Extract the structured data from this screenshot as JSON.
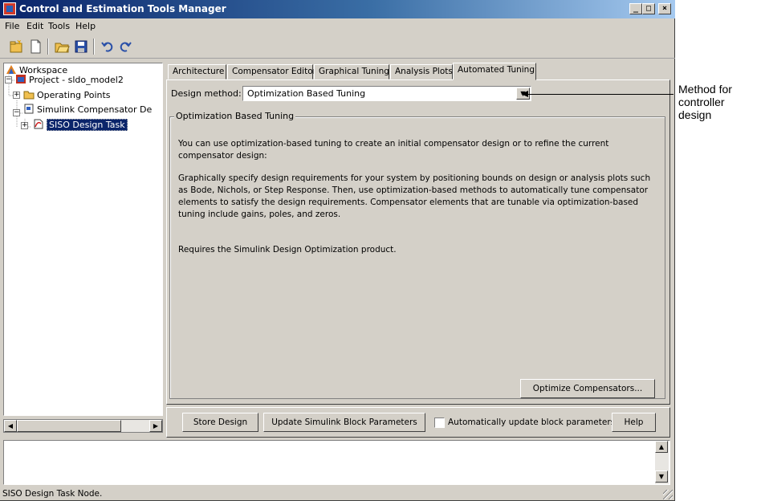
{
  "window": {
    "title": "Control and Estimation Tools Manager"
  },
  "caption_buttons": {
    "minimize": "_",
    "maximize": "□",
    "close": "×"
  },
  "menu": [
    "File",
    "Edit",
    "Tools",
    "Help"
  ],
  "toolbar_icons": [
    "new-project-icon",
    "new-task-icon",
    "open-icon",
    "save-icon",
    "undo-icon",
    "redo-icon"
  ],
  "tree": {
    "items": [
      {
        "label": "Workspace",
        "icon": "workspace-icon"
      },
      {
        "label": "Project - sldo_model2",
        "icon": "project-icon",
        "expander": "−"
      },
      {
        "label": "Operating Points",
        "icon": "folder-icon",
        "expander": "+"
      },
      {
        "label": "Simulink Compensator De",
        "icon": "document-icon",
        "expander": "−"
      },
      {
        "label": "SISO Design Task",
        "icon": "siso-task-icon",
        "expander": "+",
        "selected": true
      }
    ]
  },
  "tabs": [
    {
      "label": "Architecture"
    },
    {
      "label": "Compensator Editor"
    },
    {
      "label": "Graphical Tuning"
    },
    {
      "label": "Analysis Plots"
    },
    {
      "label": "Automated Tuning",
      "active": true
    }
  ],
  "design_method": {
    "label": "Design method:",
    "selected": "Optimization Based Tuning"
  },
  "group": {
    "title": "Optimization Based Tuning",
    "paragraphs": [
      "You can use optimization-based tuning to create an initial compensator design or to refine the current compensator design:",
      "Graphically specify design requirements for your system by positioning bounds on design or analysis plots such as Bode, Nichols, or Step Response. Then, use optimization-based methods to automatically tune compensator elements to satisfy the design requirements. Compensator elements that are tunable via optimization-based tuning include gains, poles, and zeros.",
      "Requires the Simulink Design Optimization product."
    ],
    "optimize_button": "Optimize Compensators..."
  },
  "bottom": {
    "store_design": "Store Design",
    "update_params": "Update Simulink Block Parameters",
    "auto_update_label": "Automatically update block parameters",
    "auto_update_checked": false,
    "help": "Help"
  },
  "status": "SISO Design Task Node.",
  "callout": "Method for controller design"
}
